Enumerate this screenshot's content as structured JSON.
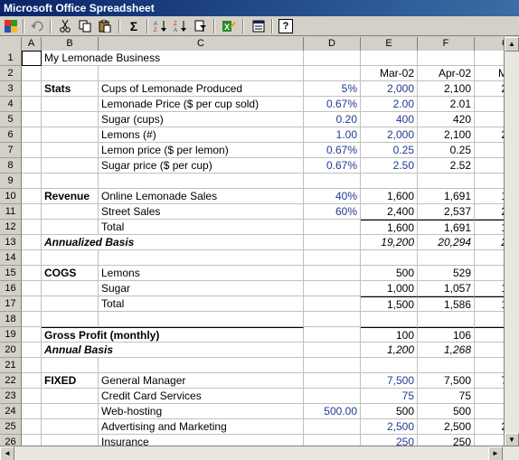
{
  "window": {
    "title": "Microsoft Office Spreadsheet"
  },
  "toolbar": {
    "icons": [
      "office-logo-icon",
      "undo-icon",
      "cut-icon",
      "copy-icon",
      "paste-icon",
      "autosum-icon",
      "sort-ascending-icon",
      "sort-descending-icon",
      "autofilter-icon",
      "export-excel-icon",
      "commands-options-icon",
      "help-icon"
    ],
    "autosum_glyph": "Σ",
    "help_glyph": "?"
  },
  "columns": [
    "A",
    "B",
    "C",
    "D",
    "E",
    "F",
    "G"
  ],
  "rows": [
    {
      "n": "1",
      "b": "",
      "c": "My Lemonade Business",
      "d": "",
      "e": "",
      "f": "",
      "g": ""
    },
    {
      "n": "2",
      "b": "",
      "c": "",
      "d": "",
      "e": "Mar-02",
      "f": "Apr-02",
      "g": "M"
    },
    {
      "n": "3",
      "b": "Stats",
      "c": "Cups of Lemonade Produced",
      "d": "5%",
      "e": "2,000",
      "f": "2,100",
      "g": "2"
    },
    {
      "n": "4",
      "b": "",
      "c": "Lemonade Price ($ per cup sold)",
      "d": "0.67%",
      "e": "2.00",
      "f": "2.01",
      "g": ""
    },
    {
      "n": "5",
      "b": "",
      "c": "Sugar (cups)",
      "d": "0.20",
      "e": "400",
      "f": "420",
      "g": ""
    },
    {
      "n": "6",
      "b": "",
      "c": "Lemons (#)",
      "d": "1.00",
      "e": "2,000",
      "f": "2,100",
      "g": "2"
    },
    {
      "n": "7",
      "b": "",
      "c": "Lemon price ($ per lemon)",
      "d": "0.67%",
      "e": "0.25",
      "f": "0.25",
      "g": ""
    },
    {
      "n": "8",
      "b": "",
      "c": "Sugar price ($ per cup)",
      "d": "0.67%",
      "e": "2.50",
      "f": "2.52",
      "g": ""
    },
    {
      "n": "9",
      "b": "",
      "c": "",
      "d": "",
      "e": "",
      "f": "",
      "g": ""
    },
    {
      "n": "10",
      "b": "Revenue",
      "c": "Online Lemonade Sales",
      "d": "40%",
      "e": "1,600",
      "f": "1,691",
      "g": "1"
    },
    {
      "n": "11",
      "b": "",
      "c": "Street Sales",
      "d": "60%",
      "e": "2,400",
      "f": "2,537",
      "g": "2"
    },
    {
      "n": "12",
      "b": "",
      "c": "Total",
      "d": "",
      "e": "1,600",
      "f": "1,691",
      "g": "1"
    },
    {
      "n": "13",
      "b": "Annualized Basis",
      "c": "",
      "d": "",
      "e": "19,200",
      "f": "20,294",
      "g": "2"
    },
    {
      "n": "14",
      "b": "",
      "c": "",
      "d": "",
      "e": "",
      "f": "",
      "g": ""
    },
    {
      "n": "15",
      "b": "COGS",
      "c": "Lemons",
      "d": "",
      "e": "500",
      "f": "529",
      "g": ""
    },
    {
      "n": "16",
      "b": "",
      "c": "Sugar",
      "d": "",
      "e": "1,000",
      "f": "1,057",
      "g": "1"
    },
    {
      "n": "17",
      "b": "",
      "c": "Total",
      "d": "",
      "e": "1,500",
      "f": "1,586",
      "g": "1"
    },
    {
      "n": "18",
      "b": "",
      "c": "",
      "d": "",
      "e": "",
      "f": "",
      "g": ""
    },
    {
      "n": "19",
      "b": "Gross Profit (monthly)",
      "c": "",
      "d": "",
      "e": "100",
      "f": "106",
      "g": ""
    },
    {
      "n": "20",
      "b": "Annual Basis",
      "c": "",
      "d": "",
      "e": "1,200",
      "f": "1,268",
      "g": ""
    },
    {
      "n": "21",
      "b": "",
      "c": "",
      "d": "",
      "e": "",
      "f": "",
      "g": ""
    },
    {
      "n": "22",
      "b": "FIXED",
      "c": "General Manager",
      "d": "",
      "e": "7,500",
      "f": "7,500",
      "g": "7"
    },
    {
      "n": "23",
      "b": "",
      "c": "Credit Card Services",
      "d": "",
      "e": "75",
      "f": "75",
      "g": ""
    },
    {
      "n": "24",
      "b": "",
      "c": "Web-hosting",
      "d": "500.00",
      "e": "500",
      "f": "500",
      "g": ""
    },
    {
      "n": "25",
      "b": "",
      "c": "Advertising and Marketing",
      "d": "",
      "e": "2,500",
      "f": "2,500",
      "g": "2"
    },
    {
      "n": "26",
      "b": "",
      "c": "Insurance",
      "d": "",
      "e": "250",
      "f": "250",
      "g": ""
    }
  ],
  "scroll": {
    "up": "▲",
    "down": "▼",
    "left": "◄",
    "right": "►"
  }
}
